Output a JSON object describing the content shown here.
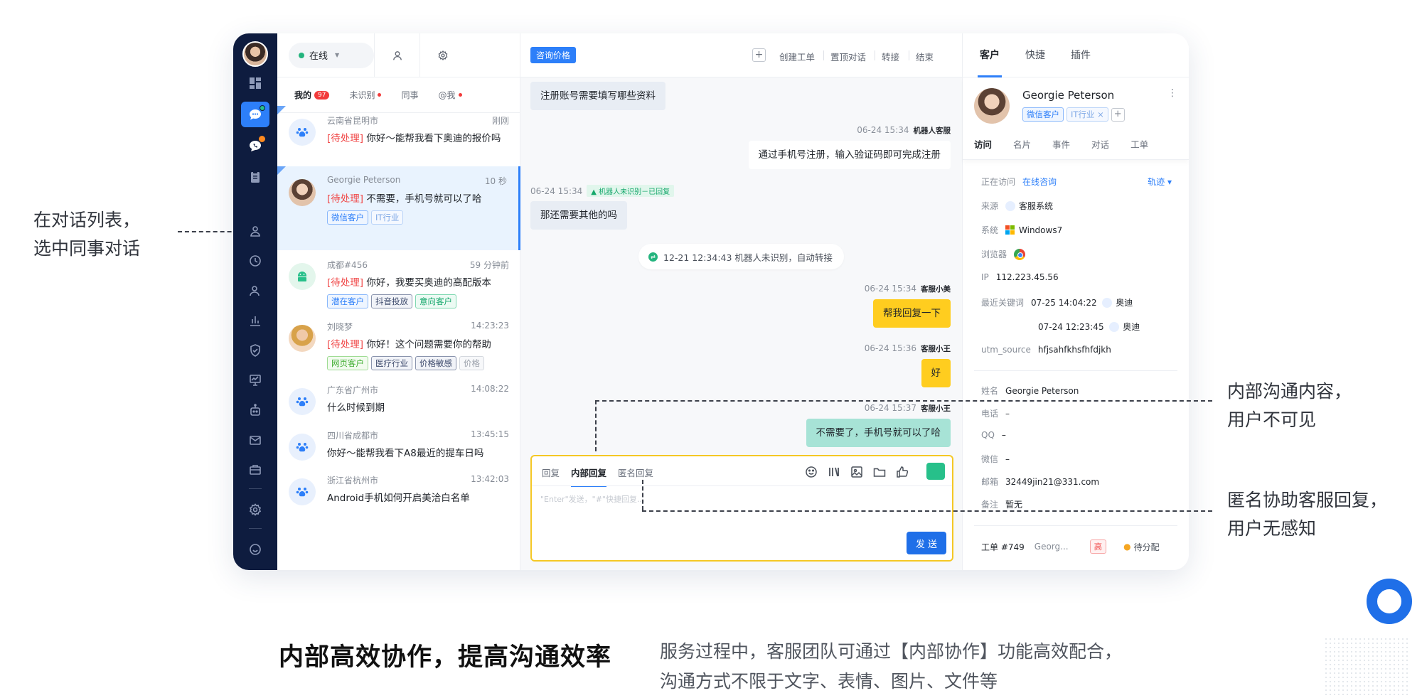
{
  "rail": {
    "icons": [
      "dashboard-icon",
      "chat-icon",
      "phone-chat-icon",
      "clipboard-icon",
      "contacts-icon",
      "history-icon",
      "user-icon",
      "stats-icon",
      "shield-icon",
      "monitor-icon",
      "robot-icon",
      "mail-icon",
      "ticket-icon",
      "settings-icon",
      "feedback-icon"
    ]
  },
  "status": {
    "label": "在线"
  },
  "list_tabs": [
    {
      "label": "我的",
      "count": "97"
    },
    {
      "label": "未识别"
    },
    {
      "label": "同事"
    },
    {
      "label": "@我"
    }
  ],
  "conversations": [
    {
      "location": "云南省昆明市",
      "time": "刚刚",
      "status": "[待处理]",
      "message": " 你好～能帮我看下奥迪的报价吗",
      "tags": []
    },
    {
      "location": "Georgie Peterson",
      "time": "10 秒",
      "status": "[待处理]",
      "message": " 不需要，手机号就可以了哈",
      "tags": [
        {
          "text": "微信客户",
          "style": "blue"
        },
        {
          "text": "IT行业",
          "style": "lblue"
        }
      ]
    },
    {
      "location": "成都#456",
      "time": "59 分钟前",
      "status": "[待处理]",
      "message": " 你好，我要买奥迪的高配版本",
      "tags": [
        {
          "text": "潜在客户",
          "style": "blue"
        },
        {
          "text": "抖音投放",
          "style": "navy"
        },
        {
          "text": "意向客户",
          "style": "green"
        }
      ]
    },
    {
      "location": "刘晓梦",
      "time": "14:23:23",
      "status": "[待处理]",
      "message": " 你好！这个问题需要你的帮助",
      "tags": [
        {
          "text": "网页客户",
          "style": "lgreen"
        },
        {
          "text": "医疗行业",
          "style": "navy"
        },
        {
          "text": "价格敏感",
          "style": "navy"
        },
        {
          "text": "价格",
          "style": "gray"
        }
      ]
    },
    {
      "location": "广东省广州市",
      "time": "14:08:22",
      "status": "",
      "message": "什么时候到期",
      "tags": []
    },
    {
      "location": "四川省成都市",
      "time": "13:45:15",
      "status": "",
      "message": "你好～能帮我看下A8最近的提车日吗",
      "tags": []
    },
    {
      "location": "浙江省杭州市",
      "time": "13:42:03",
      "status": "",
      "message": "Android手机如何开启美洽白名单",
      "tags": []
    }
  ],
  "chat": {
    "topic_chip": "咨询价格",
    "actions": [
      "创建工单",
      "置顶对话",
      "转接",
      "结束"
    ],
    "messages": {
      "m1": "注册账号需要填写哪些资料",
      "m2_meta": "06-24 15:34",
      "m2_sender": "机器人客服",
      "m2": "通过手机号注册，输入验证码即可完成注册",
      "m3_meta": "06-24 15:34",
      "m3_robot": "机器人未识别－已回复",
      "m3": "那还需要其他的吗",
      "sys": "12-21 12:34:43  机器人未识别，自动转接",
      "m4_meta": "06-24 15:34",
      "m4_sender": "客服小美",
      "m4": "帮我回复一下",
      "m5_meta": "06-24 15:36",
      "m5_sender": "客服小王",
      "m5": "好",
      "m6_meta": "06-24 15:37",
      "m6_sender": "客服小王",
      "m6": "不需要了，手机号就可以了哈"
    },
    "composer": {
      "tabs": [
        "回复",
        "内部回复",
        "匿名回复"
      ],
      "placeholder": "\"Enter\"发送，\"#\"快捷回复...",
      "send": "发 送"
    }
  },
  "panel": {
    "tabs": [
      "客户",
      "快捷",
      "插件"
    ],
    "name": "Georgie Peterson",
    "tags": [
      {
        "text": "微信客户",
        "style": "blue"
      },
      {
        "text": "IT行业 ×",
        "style": "lblue"
      }
    ],
    "subtabs": [
      "访问",
      "名片",
      "事件",
      "对话",
      "工单"
    ],
    "visiting_label": "正在访问",
    "visiting_value": "在线咨询",
    "track": "轨迹 ▾",
    "source_label": "来源",
    "source_value": "客服系统",
    "os_label": "系统",
    "os_value": "Windows7",
    "browser_label": "浏览器",
    "ip_label": "IP",
    "ip_value": "112.223.45.56",
    "kw_label": "最近关键词",
    "kw1_time": "07-25 14:04:22",
    "kw1_value": "奥迪",
    "kw2_time": "07-24 12:23:45",
    "kw2_value": "奥迪",
    "utm_label": "utm_source",
    "utm_value": "hfjsahfkhsfhfdjkh",
    "f_name_label": "姓名",
    "f_name_value": "Georgie Peterson",
    "f_phone_label": "电话",
    "f_phone_value": "–",
    "f_qq_label": "QQ",
    "f_qq_value": "–",
    "f_wx_label": "微信",
    "f_wx_value": "–",
    "f_mail_label": "邮箱",
    "f_mail_value": "32449jin21@331.com",
    "f_note_label": "备注",
    "f_note_value": "暂无",
    "ticket_no": "工单 #749",
    "ticket_owner": "Georg...",
    "ticket_priority": "高",
    "ticket_status": "待分配"
  },
  "annotations": {
    "left_1": "在对话列表，",
    "left_2": "选中同事对话",
    "right_a1": "内部沟通内容，",
    "right_a2": "用户不可见",
    "right_b1": "匿名协助客服回复，",
    "right_b2": "用户无感知"
  },
  "footer": {
    "title": "内部高效协作，提高沟通效率",
    "desc_1": "服务过程中，客服团队可通过【内部协作】功能高效配合，",
    "desc_2": "沟通方式不限于文字、表情、图片、文件等"
  },
  "colors": {
    "accent": "#2d7ff9",
    "nav_bg": "#0e1c3f",
    "internal_border": "#f5c825",
    "pending": "#f04848"
  }
}
